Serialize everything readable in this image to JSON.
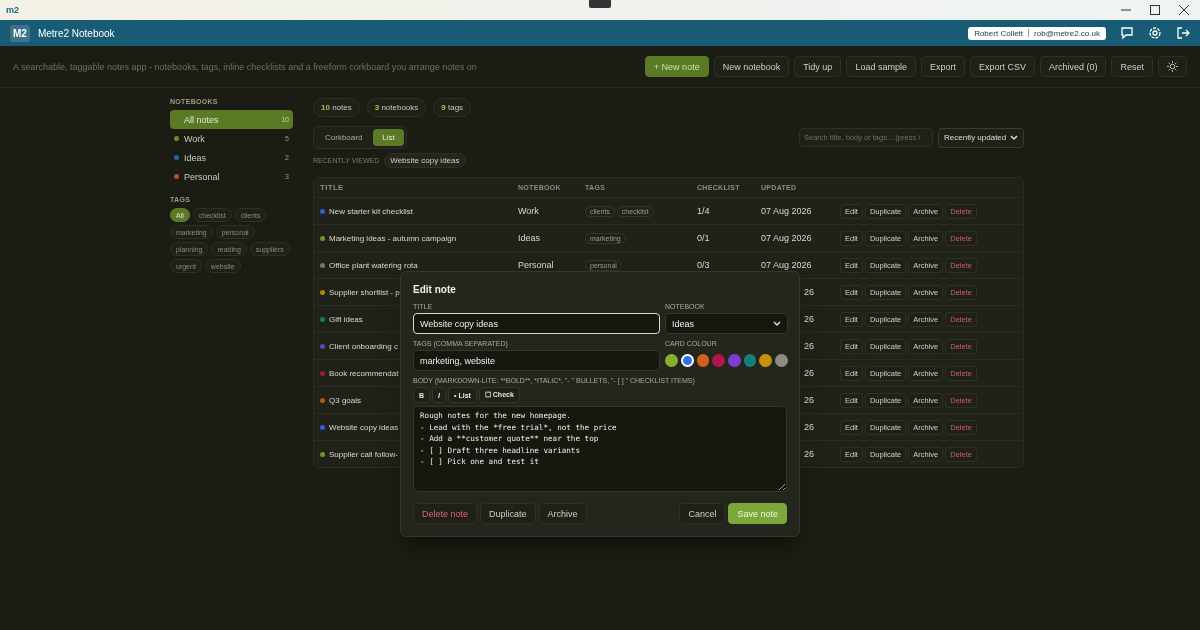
{
  "window": {
    "logo": "m2"
  },
  "header": {
    "badge": "M2",
    "title": "Metre2 Notebook",
    "user_name": "Robert Collett",
    "user_email": "rob@metre2.co.uk"
  },
  "toolbar": {
    "description": "A searchable, taggable notes app - notebooks, tags, inline checklists and a freeform corkboard you arrange notes on",
    "buttons": [
      {
        "label": "+ New note",
        "kind": "primary"
      },
      {
        "label": "New notebook",
        "kind": "plain"
      },
      {
        "label": "Tidy up",
        "kind": "plain"
      },
      {
        "label": "Load sample",
        "kind": "plain"
      },
      {
        "label": "Export",
        "kind": "plain"
      },
      {
        "label": "Export CSV",
        "kind": "plain"
      },
      {
        "label": "Archived (0)",
        "kind": "plain"
      },
      {
        "label": "Reset",
        "kind": "plain"
      }
    ]
  },
  "sidebar": {
    "notebooks_heading": "NOTEBOOKS",
    "notebooks": [
      {
        "label": "All notes",
        "count": "10",
        "selected": true
      },
      {
        "label": "Work",
        "count": "5",
        "color": "#6b8e23",
        "selected": false
      },
      {
        "label": "Ideas",
        "count": "2",
        "color": "#2f5fb3",
        "selected": false
      },
      {
        "label": "Personal",
        "count": "3",
        "color": "#b5561a",
        "selected": false
      }
    ],
    "tags_heading": "TAGS",
    "tags": [
      {
        "label": "All",
        "selected": true
      },
      {
        "label": "checklist",
        "selected": false
      },
      {
        "label": "clients",
        "selected": false
      },
      {
        "label": "marketing",
        "selected": false
      },
      {
        "label": "personal",
        "selected": false
      },
      {
        "label": "planning",
        "selected": false
      },
      {
        "label": "reading",
        "selected": false
      },
      {
        "label": "suppliers",
        "selected": false
      },
      {
        "label": "urgent",
        "selected": false
      },
      {
        "label": "website",
        "selected": false
      }
    ]
  },
  "stats": [
    {
      "value": "10",
      "label": "notes"
    },
    {
      "value": "3",
      "label": "notebooks"
    },
    {
      "value": "9",
      "label": "tags"
    }
  ],
  "view_toggle": [
    {
      "label": "Corkboard",
      "selected": false
    },
    {
      "label": "List",
      "selected": true
    }
  ],
  "search": {
    "placeholder": "Search title, body or tags... (press /"
  },
  "sort": {
    "value": "Recently updated"
  },
  "recent": {
    "label": "RECENTLY VIEWED",
    "items": [
      "Website copy ideas"
    ]
  },
  "table": {
    "columns": [
      "TITLE",
      "NOTEBOOK",
      "TAGS",
      "CHECKLIST",
      "UPDATED"
    ],
    "rows": [
      {
        "title": "New starter kit checklist",
        "color": "#2f5fd0",
        "notebook": "Work",
        "tags": [
          "clients",
          "checklist"
        ],
        "checklist": "1/4",
        "updated": "07 Aug 2026",
        "actions": [
          "Edit",
          "Duplicate",
          "Archive",
          "Delete"
        ]
      },
      {
        "title": "Marketing ideas - autumn campaign",
        "color": "#6b9a2a",
        "notebook": "Ideas",
        "tags": [
          "marketing"
        ],
        "checklist": "0/1",
        "updated": "07 Aug 2026",
        "actions": [
          "Edit",
          "Duplicate",
          "Archive",
          "Delete"
        ]
      },
      {
        "title": "Office plant watering rota",
        "color": "#77756f",
        "notebook": "Personal",
        "tags": [
          "personal"
        ],
        "checklist": "0/3",
        "updated": "07 Aug 2026",
        "actions": [
          "Edit",
          "Duplicate",
          "Archive",
          "Delete"
        ]
      },
      {
        "title": "Supplier shortlist - p",
        "color": "#b38414",
        "updated": "26",
        "actions": [
          "Edit",
          "Duplicate",
          "Archive",
          "Delete"
        ]
      },
      {
        "title": "Gift ideas",
        "color": "#167a6f",
        "updated": "26",
        "actions": [
          "Edit",
          "Duplicate",
          "Archive",
          "Delete"
        ]
      },
      {
        "title": "Client onboarding c",
        "color": "#6d3fc0",
        "updated": "26",
        "actions": [
          "Edit",
          "Duplicate",
          "Archive",
          "Delete"
        ]
      },
      {
        "title": "Book recommendat",
        "color": "#a3173f",
        "updated": "26",
        "actions": [
          "Edit",
          "Duplicate",
          "Archive",
          "Delete"
        ]
      },
      {
        "title": "Q3 goals",
        "color": "#b5561a",
        "updated": "26",
        "actions": [
          "Edit",
          "Duplicate",
          "Archive",
          "Delete"
        ]
      },
      {
        "title": "Website copy ideas",
        "color": "#2f5fd0",
        "updated": "26",
        "actions": [
          "Edit",
          "Duplicate",
          "Archive",
          "Delete"
        ]
      },
      {
        "title": "Supplier call follow-",
        "color": "#6b9a2a",
        "updated": "26",
        "actions": [
          "Edit",
          "Duplicate",
          "Archive",
          "Delete"
        ]
      }
    ]
  },
  "modal": {
    "heading": "Edit note",
    "title_label": "TITLE",
    "title_value": "Website copy ideas",
    "notebook_label": "NOTEBOOK",
    "notebook_value": "Ideas",
    "tags_label": "TAGS (COMMA SEPARATED)",
    "tags_value": "marketing, website",
    "colour_label": "CARD COLOUR",
    "colours": [
      {
        "color": "#84b02e",
        "selected": false
      },
      {
        "color": "#2f72e6",
        "selected": true
      },
      {
        "color": "#d2601a",
        "selected": false
      },
      {
        "color": "#b0174a",
        "selected": false
      },
      {
        "color": "#7a3fd0",
        "selected": false
      },
      {
        "color": "#177f7a",
        "selected": false
      },
      {
        "color": "#c9900f",
        "selected": false
      },
      {
        "color": "#8e8a84",
        "selected": false
      }
    ],
    "body_label": "BODY (MARKDOWN-LITE: **BOLD**, *ITALIC*, \"- \" BULLETS, \"- [ ] \" CHECKLIST ITEMS)",
    "format_buttons": [
      {
        "label": "B",
        "kind": "bold"
      },
      {
        "label": "I",
        "kind": "italic"
      },
      {
        "label": "• List",
        "kind": "list"
      },
      {
        "label": "☐ Check",
        "kind": "check"
      }
    ],
    "body": "Rough notes for the new homepage.\n- Lead with the *free trial*, not the price\n- Add a **customer quote** near the top\n- [ ] Draft three headline variants\n- [ ] Pick one and test it",
    "left_actions": [
      {
        "label": "Delete note",
        "kind": "danger"
      },
      {
        "label": "Duplicate",
        "kind": "plain"
      },
      {
        "label": "Archive",
        "kind": "plain"
      }
    ],
    "right_actions": [
      {
        "label": "Cancel",
        "kind": "plain"
      },
      {
        "label": "Save note",
        "kind": "primary"
      }
    ]
  }
}
